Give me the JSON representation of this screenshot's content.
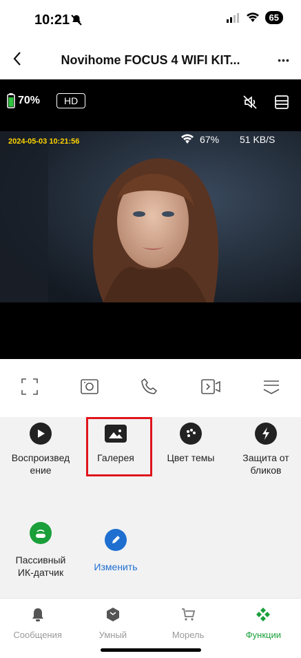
{
  "status": {
    "time": "10:21",
    "battery": "65"
  },
  "nav": {
    "title": "Novihome FOCUS 4 WIFI KIT...",
    "more": "•••"
  },
  "camera": {
    "battery": "70%",
    "quality": "HD",
    "timestamp": "2024-05-03 10:21:56",
    "wifi": "67%",
    "rate": "51 KB/S"
  },
  "functions": {
    "playback": "Воспроизвед\nение",
    "gallery": "Галерея",
    "theme": "Цвет темы",
    "antiglare": "Защита от\nбликов",
    "pir": "Пассивный\nИК-датчик",
    "edit": "Изменить"
  },
  "tabs": [
    {
      "label": "Сообщения"
    },
    {
      "label": "Умный"
    },
    {
      "label": "Морель"
    },
    {
      "label": "Функции"
    }
  ],
  "colors": {
    "active": "#1a9f3a",
    "link": "#1f6fd1",
    "highlight": "#e0141c"
  }
}
